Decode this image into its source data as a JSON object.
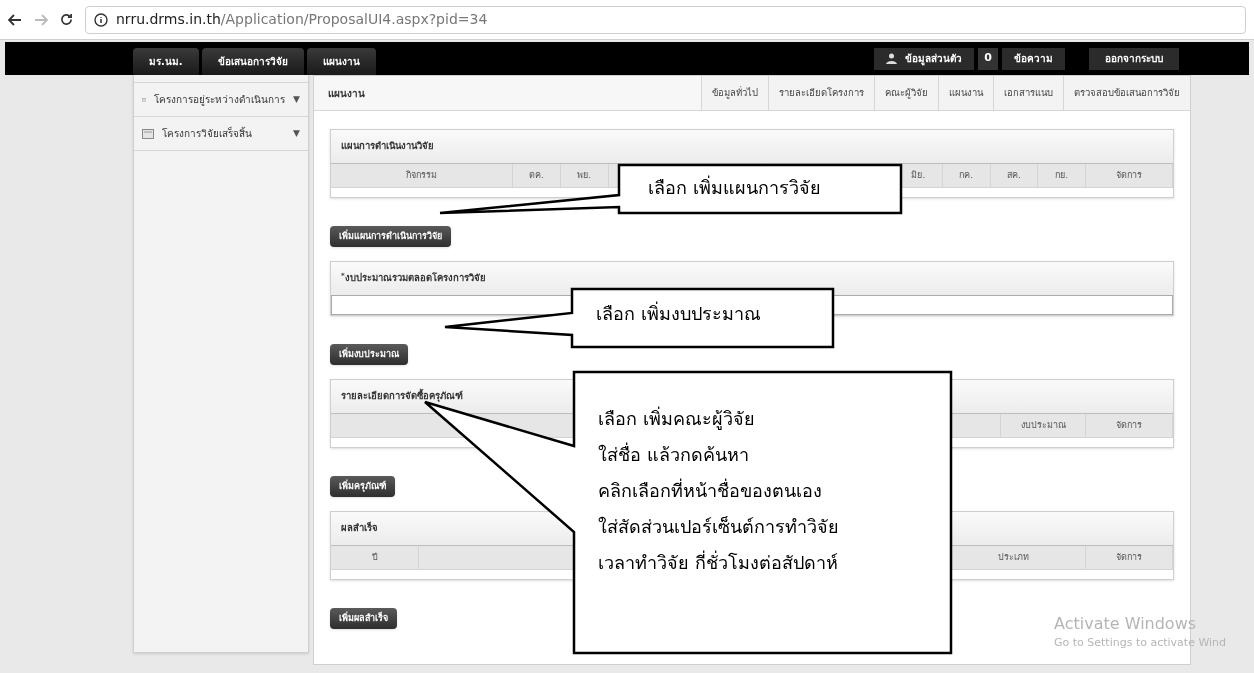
{
  "browser": {
    "url_host": "nrru.drms.in.th",
    "url_path": "/Application/ProposalUI4.aspx?pid=34"
  },
  "nav": {
    "breadcrumbs": [
      "มร.นม.",
      "ข้อเสนอการวิจัย",
      "แผนงาน"
    ],
    "profile": "ข้อมูลส่วนตัว",
    "message_count": "0",
    "messages": "ข้อความ",
    "logout": "ออกจากระบบ"
  },
  "sidebar": {
    "items": [
      {
        "label": "โครงการอยู่ระหว่างดำเนินการ",
        "toggle": "▼"
      },
      {
        "label": "โครงการวิจัยเสร็จสิ้น",
        "toggle": "▼"
      }
    ]
  },
  "page_title": "แผนงาน",
  "tabs": [
    {
      "label": "ข้อมูลทั่วไป",
      "selected": false
    },
    {
      "label": "รายละเอียดโครงการ",
      "selected": false
    },
    {
      "label": "คณะผู้วิจัย",
      "selected": false
    },
    {
      "label": "แผนงาน",
      "selected": false
    },
    {
      "label": "เอกสารแนบ",
      "selected": false
    },
    {
      "label": "ตรวจสอบข้อเสนอการวิจัย",
      "selected": false
    }
  ],
  "sections": [
    {
      "kind": "table",
      "title": "แผนการดำเนินงานวิจัย",
      "columns": [
        {
          "label": "กิจกรรม"
        },
        {
          "label": "ตค."
        },
        {
          "label": "พย."
        },
        {},
        {},
        {},
        {},
        {},
        {},
        {
          "label": "มิย."
        },
        {
          "label": "กค."
        },
        {
          "label": "สค."
        },
        {
          "label": "กย."
        },
        {
          "label": "จัดการ"
        }
      ],
      "button": "เพิ่มแผนการดำเนินการวิจัย"
    },
    {
      "kind": "field",
      "title": "$^{*}$งบประมาณรวมตลอดโครงการวิจัย",
      "button": "เพิ่มงบประมาณ"
    },
    {
      "kind": "table",
      "title": "รายละเอียดการจัดซื้อครุภัณฑ์",
      "columns": [
        {},
        {
          "label": "งบประมาณ"
        },
        {
          "label": "จัดการ"
        }
      ],
      "button": "เพิ่มครุภัณฑ์"
    },
    {
      "kind": "table",
      "title": "ผลสำเร็จ",
      "columns": [
        {
          "label": "ปี"
        },
        {},
        {
          "label": "ประเภท"
        },
        {
          "label": "จัดการ"
        }
      ],
      "button": "เพิ่มผลสำเร็จ"
    }
  ],
  "callouts": [
    {
      "lines": [
        "เลือก เพิ่มแผนการวิจัย"
      ]
    },
    {
      "lines": [
        "เลือก เพิ่มงบประมาณ"
      ]
    },
    {
      "lines": [
        "เลือก เพิ่มคณะผู้วิจัย",
        "ใส่ชื่อ แล้วกดค้นหา",
        "คลิกเลือกที่หน้าชื่อของตนเอง",
        "ใส่สัดส่วนเปอร์เซ็นต์การทำวิจัย",
        "เวลาทำวิจัย กี่ชั่วโมงต่อสัปดาห์"
      ]
    }
  ],
  "os_notice": [
    "Activate Windows",
    "Go to Settings to activate Wind"
  ]
}
